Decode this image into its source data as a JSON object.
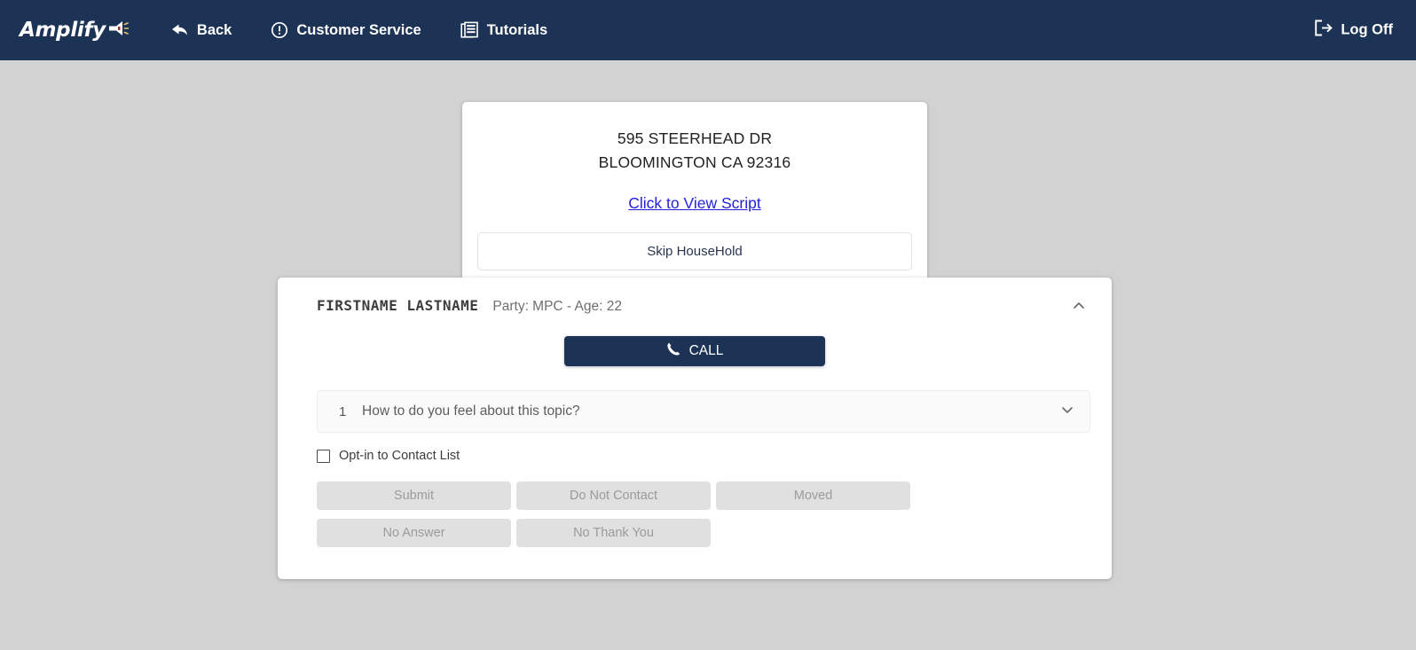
{
  "header": {
    "brand": {
      "name": "Amplify",
      "icon": "megaphone-icon"
    },
    "nav": [
      {
        "label": "Back",
        "icon": "back-arrow-icon"
      },
      {
        "label": "Customer Service",
        "icon": "exclamation-circle-icon"
      },
      {
        "label": "Tutorials",
        "icon": "book-icon"
      }
    ],
    "logoff": {
      "label": "Log Off",
      "icon": "logout-icon"
    },
    "bar_color": "#1c3356"
  },
  "address_card": {
    "street": "595 STEERHEAD DR",
    "city_state_zip": "BLOOMINGTON CA 92316",
    "script_link": "Click to View Script",
    "skip_button": "Skip HouseHold"
  },
  "contact_card": {
    "name": "FIRSTNAME  LASTNAME",
    "meta": "Party: MPC - Age: 22",
    "collapse_icon": "chevron-up-icon",
    "call_button": {
      "label": "CALL",
      "icon": "phone-icon",
      "color": "#1c3356"
    },
    "question": {
      "number": "1",
      "text": "How to do you feel about this topic?",
      "expand_icon": "chevron-down-icon"
    },
    "optin": {
      "label": "Opt-in to Contact List",
      "checked": false
    },
    "actions": [
      "Submit",
      "Do Not Contact",
      "Moved",
      "No Answer",
      "No Thank You"
    ]
  },
  "colors": {
    "page_background": "#d2d2d2",
    "card_background": "#ffffff",
    "link": "#2222dd",
    "disabled_button": "#e0e0e0"
  }
}
